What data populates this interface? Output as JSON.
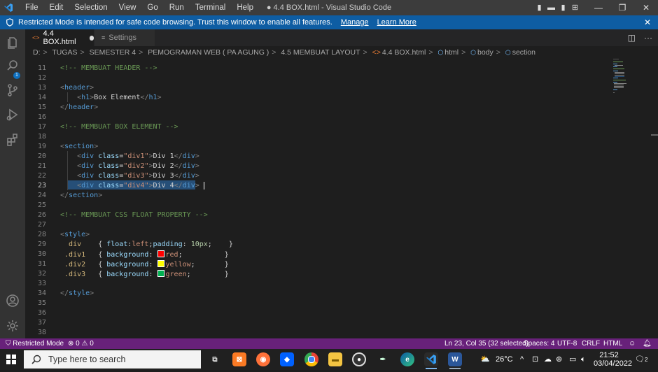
{
  "titlebar": {
    "menu": [
      "File",
      "Edit",
      "Selection",
      "View",
      "Go",
      "Run",
      "Terminal",
      "Help"
    ],
    "title": "● 4.4 BOX.html - Visual Studio Code",
    "controls": {
      "minimize": "—",
      "maximize": "❐",
      "close": "✕"
    }
  },
  "banner": {
    "message": "Restricted Mode is intended for safe code browsing. Trust this window to enable all features.",
    "manage": "Manage",
    "learn_more": "Learn More",
    "close": "✕"
  },
  "activity": {
    "badge": "1"
  },
  "tabs": {
    "active": {
      "label": "4.4 BOX.html"
    },
    "settings": {
      "label": "Settings"
    }
  },
  "breadcrumb": {
    "parts": [
      "D:",
      "TUGAS",
      "SEMESTER 4",
      "PEMOGRAMAN WEB ( PA AGUNG )",
      "4.5 MEMBUAT LAYOUT"
    ],
    "file": "4.4 BOX.html",
    "symbols": [
      "html",
      "body",
      "section"
    ]
  },
  "editor": {
    "top_partial_line": "10",
    "line_numbers": [
      "11",
      "12",
      "13",
      "14",
      "15",
      "16",
      "17",
      "18",
      "19",
      "20",
      "21",
      "22",
      "23",
      "24",
      "25",
      "26",
      "27",
      "28",
      "29",
      "30",
      "31",
      "32",
      "33",
      "34",
      "35",
      "36",
      "37",
      "38"
    ],
    "active_line": "23",
    "colors": {
      "red": "#ff0000",
      "yellow": "#ffff00",
      "green": "#00b050"
    }
  },
  "status": {
    "restricted": "Restricted Mode",
    "errors": "0",
    "warnings": "0",
    "position": "Ln 23, Col 35 (32 selected)",
    "spaces": "Spaces: 4",
    "encoding": "UTF-8",
    "eol": "CRLF",
    "language": "HTML"
  },
  "taskbar": {
    "search_placeholder": "Type here to search",
    "temperature": "26°C",
    "time": "21:52",
    "date": "03/04/2022",
    "notifications": "2"
  }
}
